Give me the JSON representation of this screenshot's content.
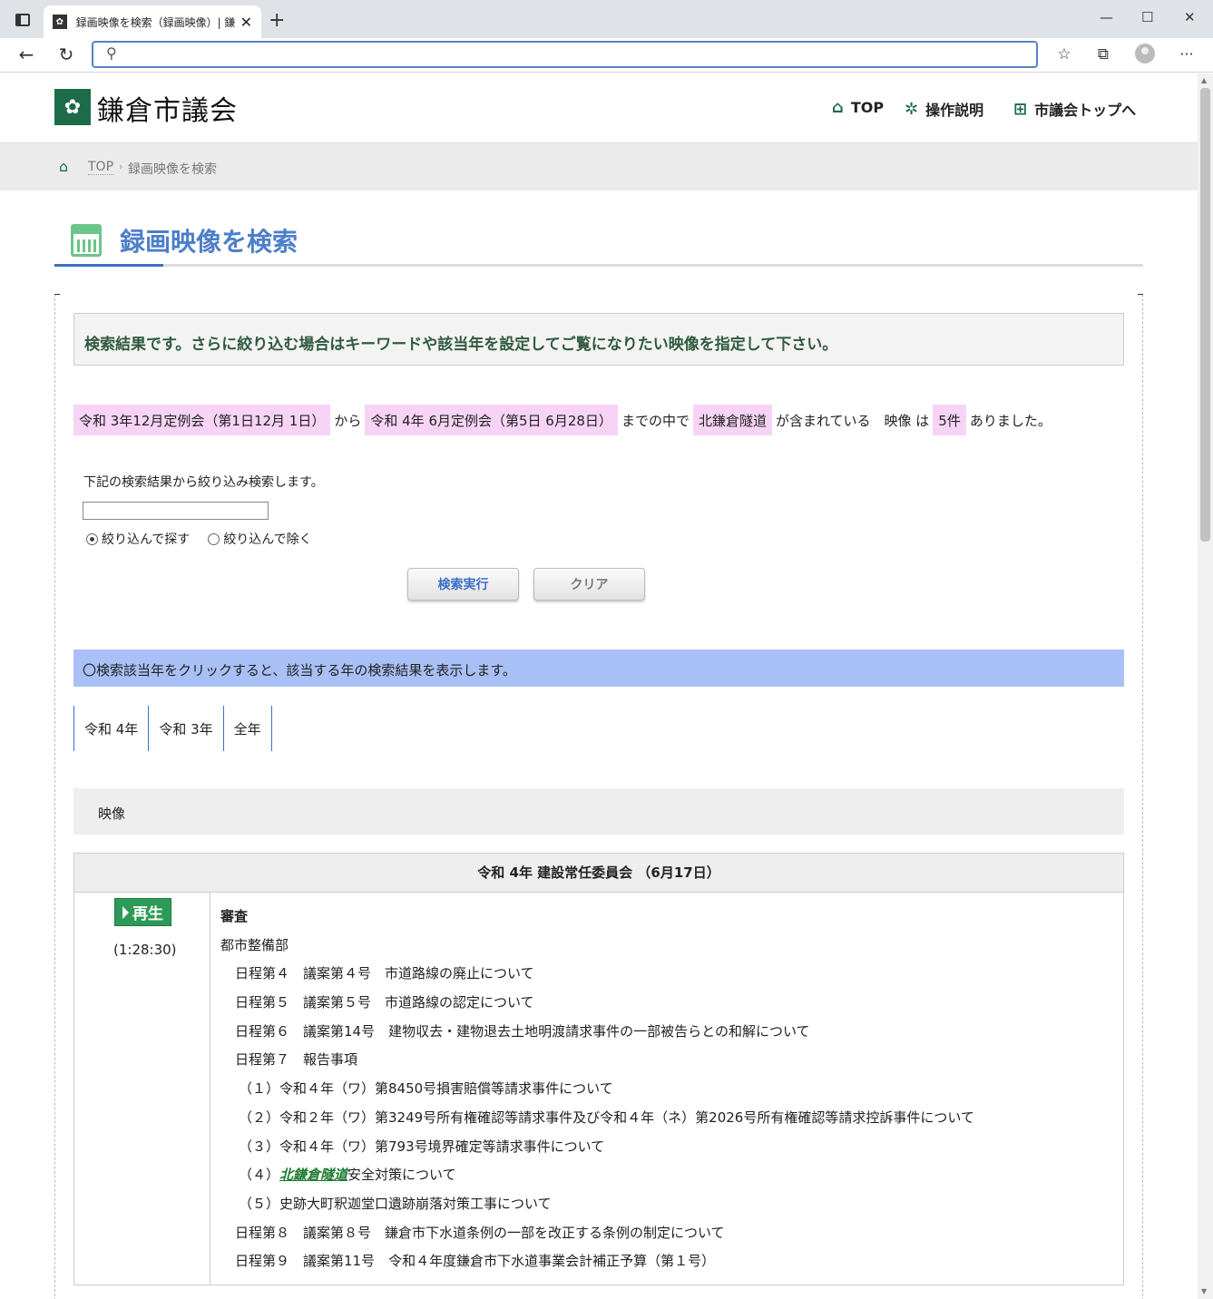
{
  "browser": {
    "tab_title": "録画映像を検索（録画映像）| 鎌",
    "tab_close": "✕",
    "new_tab": "+",
    "url_value": "",
    "window_controls": {
      "minimize": "—",
      "maximize": "☐",
      "close": "✕"
    },
    "icons": [
      "back-icon",
      "reload-icon",
      "search-icon",
      "favorites-icon",
      "collections-icon",
      "profile-icon",
      "more-icon"
    ]
  },
  "header": {
    "site_name": "鎌倉市議会",
    "nav": [
      {
        "label": "TOP",
        "icon": "home-icon"
      },
      {
        "label": "操作説明",
        "icon": "gear-icon"
      },
      {
        "label": "市議会トップへ",
        "icon": "sitemap-icon"
      }
    ]
  },
  "breadcrumb": {
    "top": "TOP",
    "separator": "›",
    "current": "録画映像を検索"
  },
  "page_title": "録画映像を検索",
  "notice": "検索結果です。さらに絞り込む場合はキーワードや該当年を設定してご覧になりたい映像を指定して下さい。",
  "result": {
    "from": "令和 3年12月定例会（第1日12月 1日）",
    "from_suffix": "から",
    "to": "令和 4年 6月定例会（第5日 6月28日）",
    "to_suffix": "までの中で",
    "keyword": "北鎌倉隧道",
    "keyword_suffix": "が含まれている　映像 は",
    "count": "5件",
    "count_suffix": "ありました。"
  },
  "refine": {
    "label": "下記の検索結果から絞り込み検索します。",
    "input_value": "",
    "radio_include": "絞り込んで探す",
    "radio_exclude": "絞り込んで除く",
    "search_button": "検索実行",
    "clear_button": "クリア"
  },
  "year_filter": {
    "hint": "〇検索該当年をクリックすると、該当する年の検索結果を表示します。",
    "tabs": [
      "令和 4年",
      "令和 3年",
      "全年"
    ]
  },
  "video_section_label": "映像",
  "meeting": {
    "title": "令和 4年 建設常任委員会 （6月17日）",
    "play_label": "再生",
    "duration": "(1:28:30)",
    "lines": [
      {
        "text": "審査"
      },
      {
        "text": "都市整備部"
      },
      {
        "text": "日程第４　議案第４号　市道路線の廃止について"
      },
      {
        "text": "日程第５　議案第５号　市道路線の認定について"
      },
      {
        "text": "日程第６　議案第14号　建物収去・建物退去土地明渡請求事件の一部被告らとの和解について"
      },
      {
        "text": "日程第７　報告事項"
      },
      {
        "text": "（１）令和４年（ワ）第8450号損害賠償等請求事件について"
      },
      {
        "text": "（２）令和２年（ワ）第3249号所有権確認等請求事件及び令和４年（ネ）第2026号所有権確認等請求控訴事件について"
      },
      {
        "text": "（３）令和４年（ワ）第793号境界確定等請求事件について"
      },
      {
        "prefix": "（４）",
        "keyword": "北鎌倉隧道",
        "suffix": "安全対策について"
      },
      {
        "text": "（５）史跡大町釈迦堂口遺跡崩落対策工事について"
      },
      {
        "text": "日程第８　議案第８号　鎌倉市下水道条例の一部を改正する条例の制定について"
      },
      {
        "text": "日程第９　議案第11号　令和４年度鎌倉市下水道事業会計補正予算（第１号）"
      }
    ]
  },
  "colors": {
    "brand_green": "#1e6b4a",
    "title_blue": "#4d7fc9",
    "highlight_pink": "#f7d4f5",
    "year_bar_blue": "#a8c0f5",
    "play_green": "#2e9a57"
  }
}
